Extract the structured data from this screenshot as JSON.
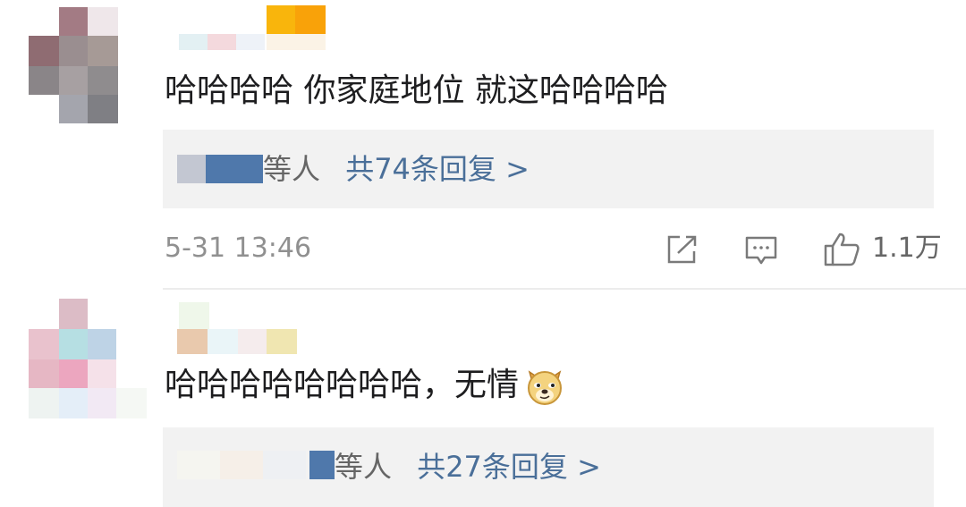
{
  "comments": [
    {
      "text": "哈哈哈哈 你家庭地位 就这哈哈哈哈",
      "replies": {
        "suffix": "等人",
        "link": "共74条回复 >"
      },
      "time": "5-31 13:46",
      "likes": "1.1万",
      "icons": [
        "share-icon",
        "comment-icon",
        "like-icon"
      ]
    },
    {
      "text": "哈哈哈哈哈哈哈哈，无情",
      "emoji": "doge-emoji",
      "replies": {
        "suffix": "等人",
        "link": "共27条回复 >"
      }
    }
  ],
  "colors": {
    "link": "#4a6f99",
    "reply_bg": "#f2f2f2",
    "meta_text": "#909090"
  }
}
